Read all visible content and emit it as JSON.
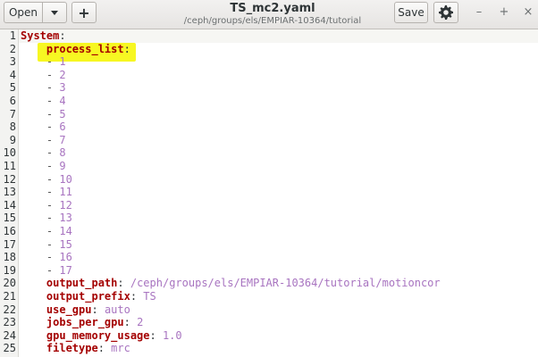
{
  "window": {
    "title": "TS_mc2.yaml",
    "subtitle": "/ceph/groups/els/EMPIAR-10364/tutorial"
  },
  "toolbar": {
    "open_label": "Open",
    "new_label": "+",
    "save_label": "Save",
    "icons": {
      "open_menu": "chevron-down-icon",
      "new": "plus-icon",
      "settings": "gear-icon",
      "minimize": "minimize-icon",
      "maximize": "maximize-icon",
      "close": "close-icon"
    },
    "window_controls": {
      "minimize": "–",
      "maximize": "+",
      "close": "×"
    }
  },
  "editor": {
    "highlight_color": "#f7f722",
    "lines": [
      {
        "n": "1",
        "indent": "",
        "key": "System",
        "sep": ":",
        "val": ""
      },
      {
        "n": "2",
        "indent": "    ",
        "key": "process_list",
        "sep": ":",
        "val": ""
      },
      {
        "n": "3",
        "indent": "    - ",
        "key": "",
        "sep": "",
        "val": "1"
      },
      {
        "n": "4",
        "indent": "    - ",
        "key": "",
        "sep": "",
        "val": "2"
      },
      {
        "n": "5",
        "indent": "    - ",
        "key": "",
        "sep": "",
        "val": "3"
      },
      {
        "n": "6",
        "indent": "    - ",
        "key": "",
        "sep": "",
        "val": "4"
      },
      {
        "n": "7",
        "indent": "    - ",
        "key": "",
        "sep": "",
        "val": "5"
      },
      {
        "n": "8",
        "indent": "    - ",
        "key": "",
        "sep": "",
        "val": "6"
      },
      {
        "n": "9",
        "indent": "    - ",
        "key": "",
        "sep": "",
        "val": "7"
      },
      {
        "n": "10",
        "indent": "    - ",
        "key": "",
        "sep": "",
        "val": "8"
      },
      {
        "n": "11",
        "indent": "    - ",
        "key": "",
        "sep": "",
        "val": "9"
      },
      {
        "n": "12",
        "indent": "    - ",
        "key": "",
        "sep": "",
        "val": "10"
      },
      {
        "n": "13",
        "indent": "    - ",
        "key": "",
        "sep": "",
        "val": "11"
      },
      {
        "n": "14",
        "indent": "    - ",
        "key": "",
        "sep": "",
        "val": "12"
      },
      {
        "n": "15",
        "indent": "    - ",
        "key": "",
        "sep": "",
        "val": "13"
      },
      {
        "n": "16",
        "indent": "    - ",
        "key": "",
        "sep": "",
        "val": "14"
      },
      {
        "n": "17",
        "indent": "    - ",
        "key": "",
        "sep": "",
        "val": "15"
      },
      {
        "n": "18",
        "indent": "    - ",
        "key": "",
        "sep": "",
        "val": "16"
      },
      {
        "n": "19",
        "indent": "    - ",
        "key": "",
        "sep": "",
        "val": "17"
      },
      {
        "n": "20",
        "indent": "    ",
        "key": "output_path",
        "sep": ": ",
        "val": "/ceph/groups/els/EMPIAR-10364/tutorial/motioncor"
      },
      {
        "n": "21",
        "indent": "    ",
        "key": "output_prefix",
        "sep": ": ",
        "val": "TS"
      },
      {
        "n": "22",
        "indent": "    ",
        "key": "use_gpu",
        "sep": ": ",
        "val": "auto"
      },
      {
        "n": "23",
        "indent": "    ",
        "key": "jobs_per_gpu",
        "sep": ": ",
        "val": "2"
      },
      {
        "n": "24",
        "indent": "    ",
        "key": "gpu_memory_usage",
        "sep": ": ",
        "val": "1.0"
      },
      {
        "n": "25",
        "indent": "    ",
        "key": "filetype",
        "sep": ": ",
        "val": "mrc"
      }
    ]
  }
}
